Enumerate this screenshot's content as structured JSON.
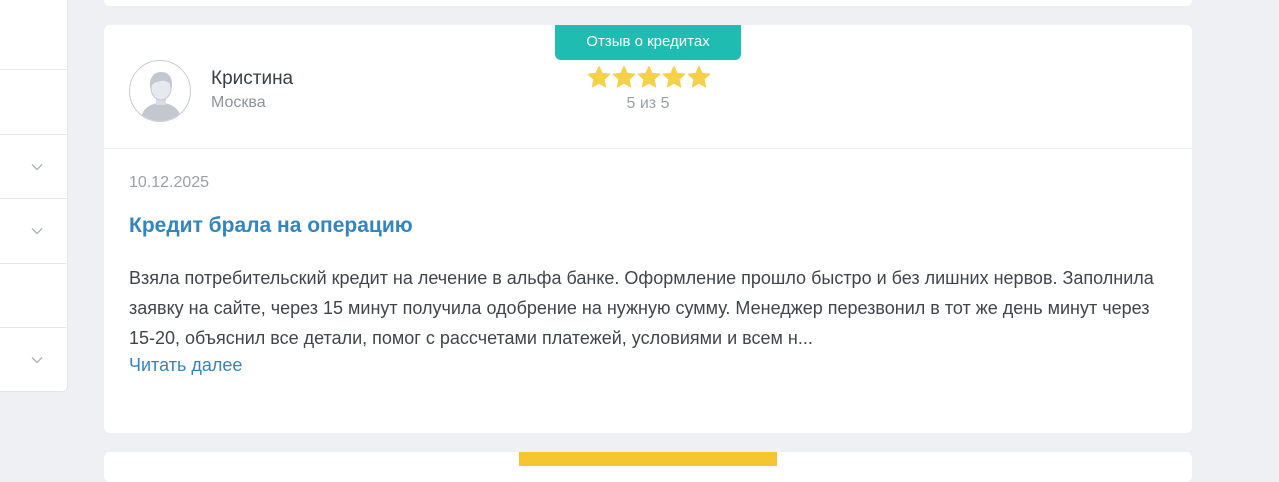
{
  "sidebar": {
    "rows": [
      {
        "has_chevron": false
      },
      {
        "has_chevron": false
      },
      {
        "has_chevron": true
      },
      {
        "has_chevron": true
      },
      {
        "has_chevron": false
      },
      {
        "has_chevron": true
      }
    ]
  },
  "review": {
    "category_badge": "Отзыв о кредитах",
    "author_name": "Кристина",
    "author_city": "Москва",
    "stars": 5,
    "rating_text": "5 из 5",
    "date": "10.12.2025",
    "title": "Кредит брала на операцию",
    "text": "Взяла потребительский кредит на лечение в альфа банке. Оформление прошло быстро и без лишних нервов. Заполнила заявку на сайте, через 15 минут получила одобрение на нужную сумму. Менеджер перезвонил в тот же день минут через 15-20, объяснил все детали, помог с рассчетами платежей, условиями и всем н...",
    "read_more": "Читать далее"
  },
  "colors": {
    "badge_teal": "#1fbcb1",
    "next_badge_yellow": "#f5c630",
    "link_blue": "#3384bf",
    "star_yellow": "#f7d04a"
  }
}
